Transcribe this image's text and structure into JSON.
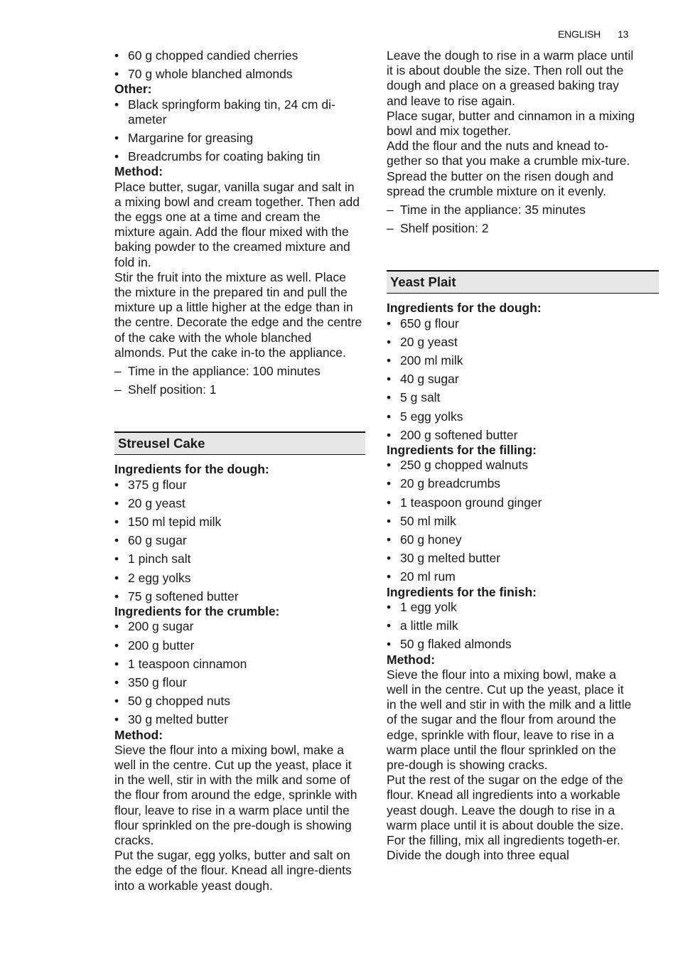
{
  "header": {
    "language": "ENGLISH",
    "page_number": "13"
  },
  "left": {
    "top_bullets": [
      "60 g chopped candied cherries",
      "70 g whole blanched almonds"
    ],
    "other_label": "Other:",
    "other_bullets": [
      "Black springform baking tin, 24 cm di-ameter",
      "Margarine for greasing",
      "Breadcrumbs for coating baking tin"
    ],
    "method_label": "Method:",
    "method_paragraphs": [
      "Place butter, sugar, vanilla sugar and salt in a mixing bowl and cream together. Then add the eggs one at a time and cream the mixture again. Add the flour mixed with the baking powder to the creamed mixture and fold in.",
      "Stir the fruit into the mixture as well. Place the mixture in the prepared tin and pull the mixture up a little higher at the edge than in the centre. Decorate the edge and the centre of the cake with the whole blanched almonds. Put the cake in-to the appliance."
    ],
    "settings": [
      "Time in the appliance: 100 minutes",
      "Shelf position: 1"
    ],
    "streusel": {
      "title": "Streusel Cake",
      "dough_label": "Ingredients for the dough:",
      "dough": [
        "375 g flour",
        "20 g yeast",
        "150 ml tepid milk",
        "60 g sugar",
        "1 pinch salt",
        "2 egg yolks",
        "75 g softened butter"
      ],
      "crumble_label": "Ingredients for the crumble:",
      "crumble": [
        "200 g sugar",
        "200 g butter",
        "1 teaspoon cinnamon",
        "350 g flour",
        "50 g chopped nuts",
        "30 g melted butter"
      ],
      "method_label": "Method:",
      "method_paragraphs": [
        "Sieve the flour into a mixing bowl, make a well in the centre. Cut up the yeast, place it in the well, stir in with the milk and some of the flour from around the edge, sprinkle with flour, leave to rise in a warm place until the flour sprinkled on the pre-dough is showing cracks.",
        "Put the sugar, egg yolks, butter and salt on the edge of the flour. Knead all ingre-dients into a workable yeast dough."
      ]
    }
  },
  "right": {
    "method_paragraphs": [
      "Leave the dough to rise in a warm place until it is about double the size. Then roll out the dough and place on a greased baking tray and leave to rise again.",
      "Place sugar, butter and cinnamon in a mixing bowl and mix together.",
      "Add the flour and the nuts and knead to-gether so that you make a crumble mix-ture.",
      "Spread the butter on the risen dough and spread the crumble mixture on it evenly."
    ],
    "settings": [
      "Time in the appliance: 35 minutes",
      "Shelf position: 2"
    ],
    "yeast_plait": {
      "title": "Yeast Plait",
      "dough_label": "Ingredients for the dough:",
      "dough": [
        "650 g flour",
        "20 g yeast",
        "200 ml milk",
        "40 g sugar",
        "5 g salt",
        "5 egg yolks",
        "200 g softened butter"
      ],
      "filling_label": "Ingredients for the filling:",
      "filling": [
        "250 g chopped walnuts",
        "20 g breadcrumbs",
        "1 teaspoon ground ginger",
        "50 ml milk",
        "60 g honey",
        "30 g melted butter",
        "20 ml rum"
      ],
      "finish_label": "Ingredients for the finish:",
      "finish": [
        "1 egg yolk",
        "a little milk",
        "50 g flaked almonds"
      ],
      "method_label": "Method:",
      "method_paragraphs": [
        "Sieve the flour into a mixing bowl, make a well in the centre. Cut up the yeast, place it in the well and stir in with the milk and a little of the sugar and the flour from around the edge, sprinkle with flour, leave to rise in a warm place until the flour sprinkled on the pre-dough is showing cracks.",
        "Put the rest of the sugar on the edge of the flour. Knead all ingredients into a workable yeast dough. Leave the dough to rise in a warm place until it is about double the size.",
        "For the filling, mix all ingredients togeth-er. Divide the dough into three equal"
      ]
    }
  }
}
